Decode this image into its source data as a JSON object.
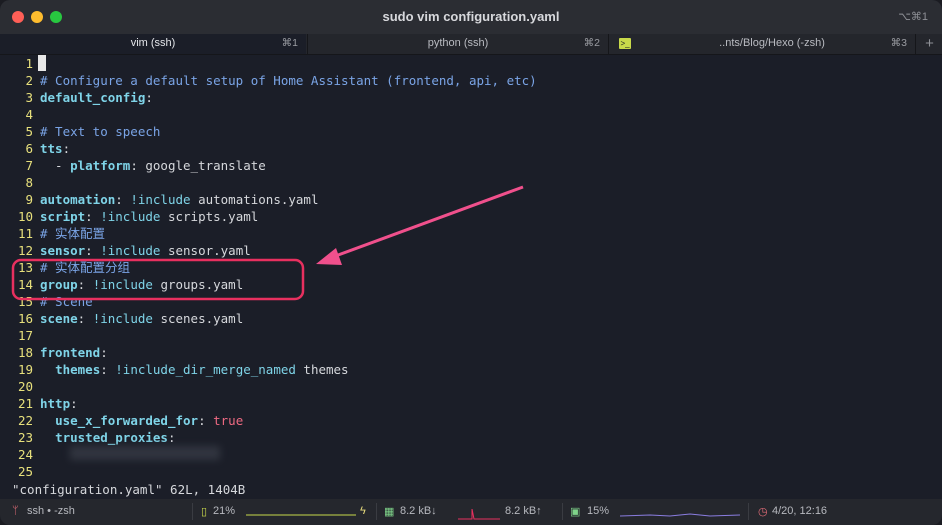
{
  "window": {
    "title": "sudo vim configuration.yaml",
    "shortcut": "⌥⌘1"
  },
  "tabs": [
    {
      "label": "vim (ssh)",
      "key": "⌘1"
    },
    {
      "label": "python (ssh)",
      "key": "⌘2"
    },
    {
      "label": "..nts/Blog/Hexo (-zsh)",
      "key": "⌘3"
    }
  ],
  "new_tab": "+",
  "editor": {
    "lines": [
      {
        "n": "1",
        "parts": []
      },
      {
        "n": "2",
        "parts": [
          {
            "c": "cm",
            "t": "# Configure a default setup of Home Assistant (frontend, api, etc)"
          }
        ]
      },
      {
        "n": "3",
        "parts": [
          {
            "c": "key-t",
            "t": "default_config"
          },
          {
            "c": "val",
            "t": ":"
          }
        ]
      },
      {
        "n": "4",
        "parts": []
      },
      {
        "n": "5",
        "parts": [
          {
            "c": "cm",
            "t": "# Text to speech"
          }
        ]
      },
      {
        "n": "6",
        "parts": [
          {
            "c": "key-t",
            "t": "tts"
          },
          {
            "c": "val",
            "t": ":"
          }
        ]
      },
      {
        "n": "7",
        "parts": [
          {
            "c": "val",
            "t": "  - "
          },
          {
            "c": "key-t",
            "t": "platform"
          },
          {
            "c": "val",
            "t": ": google_translate"
          }
        ]
      },
      {
        "n": "8",
        "parts": []
      },
      {
        "n": "9",
        "parts": [
          {
            "c": "key-t",
            "t": "automation"
          },
          {
            "c": "val",
            "t": ": "
          },
          {
            "c": "fn",
            "t": "!include"
          },
          {
            "c": "val",
            "t": " automations.yaml"
          }
        ]
      },
      {
        "n": "10",
        "parts": [
          {
            "c": "key-t",
            "t": "script"
          },
          {
            "c": "val",
            "t": ": "
          },
          {
            "c": "fn",
            "t": "!include"
          },
          {
            "c": "val",
            "t": " scripts.yaml"
          }
        ]
      },
      {
        "n": "11",
        "parts": [
          {
            "c": "cm",
            "t": "# 实体配置"
          }
        ]
      },
      {
        "n": "12",
        "parts": [
          {
            "c": "key-t",
            "t": "sensor"
          },
          {
            "c": "val",
            "t": ": "
          },
          {
            "c": "fn",
            "t": "!include"
          },
          {
            "c": "val",
            "t": " sensor.yaml"
          }
        ]
      },
      {
        "n": "13",
        "parts": [
          {
            "c": "cm",
            "t": "# 实体配置分组"
          }
        ]
      },
      {
        "n": "14",
        "parts": [
          {
            "c": "key-t",
            "t": "group"
          },
          {
            "c": "val",
            "t": ": "
          },
          {
            "c": "fn",
            "t": "!include"
          },
          {
            "c": "val",
            "t": " groups.yaml"
          }
        ]
      },
      {
        "n": "15",
        "parts": [
          {
            "c": "cm",
            "t": "# Scene"
          }
        ]
      },
      {
        "n": "16",
        "parts": [
          {
            "c": "key-t",
            "t": "scene"
          },
          {
            "c": "val",
            "t": ": "
          },
          {
            "c": "fn",
            "t": "!include"
          },
          {
            "c": "val",
            "t": " scenes.yaml"
          }
        ]
      },
      {
        "n": "17",
        "parts": []
      },
      {
        "n": "18",
        "parts": [
          {
            "c": "key-t",
            "t": "frontend"
          },
          {
            "c": "val",
            "t": ":"
          }
        ]
      },
      {
        "n": "19",
        "parts": [
          {
            "c": "val",
            "t": "  "
          },
          {
            "c": "key-t",
            "t": "themes"
          },
          {
            "c": "val",
            "t": ": "
          },
          {
            "c": "fn",
            "t": "!include_dir_merge_named"
          },
          {
            "c": "val",
            "t": " themes"
          }
        ]
      },
      {
        "n": "20",
        "parts": []
      },
      {
        "n": "21",
        "parts": [
          {
            "c": "key-t",
            "t": "http"
          },
          {
            "c": "val",
            "t": ":"
          }
        ]
      },
      {
        "n": "22",
        "parts": [
          {
            "c": "val",
            "t": "  "
          },
          {
            "c": "key-t",
            "t": "use_x_forwarded_for"
          },
          {
            "c": "val",
            "t": ": "
          },
          {
            "c": "bool",
            "t": "true"
          }
        ]
      },
      {
        "n": "23",
        "parts": [
          {
            "c": "val",
            "t": "  "
          },
          {
            "c": "key-t",
            "t": "trusted_proxies"
          },
          {
            "c": "val",
            "t": ":"
          }
        ]
      },
      {
        "n": "24",
        "parts": []
      },
      {
        "n": "25",
        "parts": []
      }
    ],
    "command_line": "\"configuration.yaml\" 62L, 1404B"
  },
  "status": {
    "session": "ssh • -zsh",
    "battery": "21%",
    "net_down": "8.2 kB↓",
    "net_up": "8.2 kB↑",
    "cpu": "15%",
    "clock": "4/20, 12:16"
  },
  "colors": {
    "annotation": "#e8305f",
    "arrow": "#f0508c",
    "line_numbers": "#e7e07c",
    "comment": "#7aa4e6",
    "keys": "#7fd4e8",
    "bool": "#ef6a82"
  }
}
